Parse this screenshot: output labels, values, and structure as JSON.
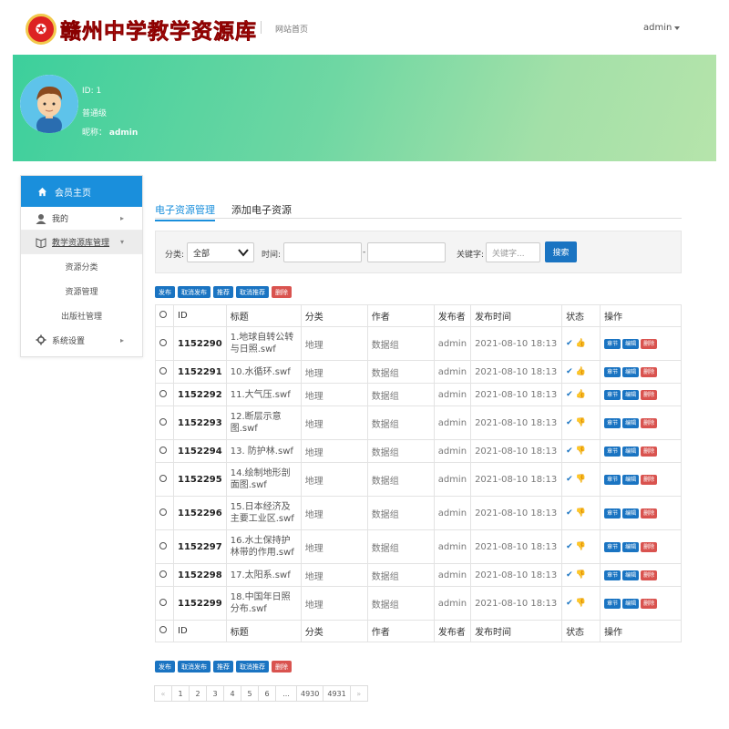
{
  "header": {
    "logo_emblem": "✪",
    "logo_text": "赣州中学教学资源库",
    "site_home": "网站首页",
    "user": "admin"
  },
  "profile": {
    "id_line": "ID: 1",
    "level_line": "普通级",
    "name_label": "昵称：",
    "name_value": "admin"
  },
  "sidebar": {
    "head": "会员主页",
    "items": [
      {
        "label": "我的",
        "icon": "user-icon",
        "arrow": "▸"
      },
      {
        "label": "教学资源库管理",
        "icon": "book-icon",
        "arrow": "▾"
      }
    ],
    "subitems": [
      "资源分类",
      "资源管理",
      "出版社管理"
    ],
    "settings": {
      "label": "系统设置",
      "icon": "gear-icon",
      "arrow": "▸"
    }
  },
  "tabs": [
    "电子资源管理",
    "添加电子资源"
  ],
  "filter": {
    "category_label": "分类:",
    "category_value": "全部",
    "time_label": "时间:",
    "dash": "-",
    "keyword_label": "关键字:",
    "keyword_placeholder": "关键字...",
    "search_btn": "搜索"
  },
  "actions": [
    "发布",
    "取消发布",
    "推荐",
    "取消推荐",
    "删除"
  ],
  "columns": [
    "ID",
    "标题",
    "分类",
    "作者",
    "发布者",
    "发布时间",
    "状态",
    "操作"
  ],
  "row_buttons": [
    "章节",
    "编辑",
    "删除"
  ],
  "rows": [
    {
      "id": "1152290",
      "title": "1.地球自转公转与日照.swf",
      "category": "地理",
      "author": "数据组",
      "publisher": "admin",
      "time": "2021-08-10 18:13",
      "status": "✔ 👍"
    },
    {
      "id": "1152291",
      "title": "10.水循环.swf",
      "category": "地理",
      "author": "数据组",
      "publisher": "admin",
      "time": "2021-08-10 18:13",
      "status": "✔ 👍"
    },
    {
      "id": "1152292",
      "title": "11.大气压.swf",
      "category": "地理",
      "author": "数据组",
      "publisher": "admin",
      "time": "2021-08-10 18:13",
      "status": "✔ 👍"
    },
    {
      "id": "1152293",
      "title": "12.断层示意图.swf",
      "category": "地理",
      "author": "数据组",
      "publisher": "admin",
      "time": "2021-08-10 18:13",
      "status": "✔ 👎"
    },
    {
      "id": "1152294",
      "title": "13. 防护林.swf",
      "category": "地理",
      "author": "数据组",
      "publisher": "admin",
      "time": "2021-08-10 18:13",
      "status": "✔ 👎"
    },
    {
      "id": "1152295",
      "title": "14.绘制地形剖面图.swf",
      "category": "地理",
      "author": "数据组",
      "publisher": "admin",
      "time": "2021-08-10 18:13",
      "status": "✔ 👎"
    },
    {
      "id": "1152296",
      "title": "15.日本经济及主要工业区.swf",
      "category": "地理",
      "author": "数据组",
      "publisher": "admin",
      "time": "2021-08-10 18:13",
      "status": "✔ 👎"
    },
    {
      "id": "1152297",
      "title": "16.水土保持护林带的作用.swf",
      "category": "地理",
      "author": "数据组",
      "publisher": "admin",
      "time": "2021-08-10 18:13",
      "status": "✔ 👎"
    },
    {
      "id": "1152298",
      "title": "17.太阳系.swf",
      "category": "地理",
      "author": "数据组",
      "publisher": "admin",
      "time": "2021-08-10 18:13",
      "status": "✔ 👎"
    },
    {
      "id": "1152299",
      "title": "18.中国年日照分布.swf",
      "category": "地理",
      "author": "数据组",
      "publisher": "admin",
      "time": "2021-08-10 18:13",
      "status": "✔ 👎"
    }
  ],
  "pagination": [
    "«",
    "1",
    "2",
    "3",
    "4",
    "5",
    "6",
    "...",
    "4930",
    "4931",
    "»"
  ],
  "colors": {
    "accent": "#1a8fdc",
    "button_blue": "#1a74c2",
    "danger": "#d9534f",
    "banner_start": "#3ccf9c",
    "banner_end": "#b6e4ab"
  }
}
